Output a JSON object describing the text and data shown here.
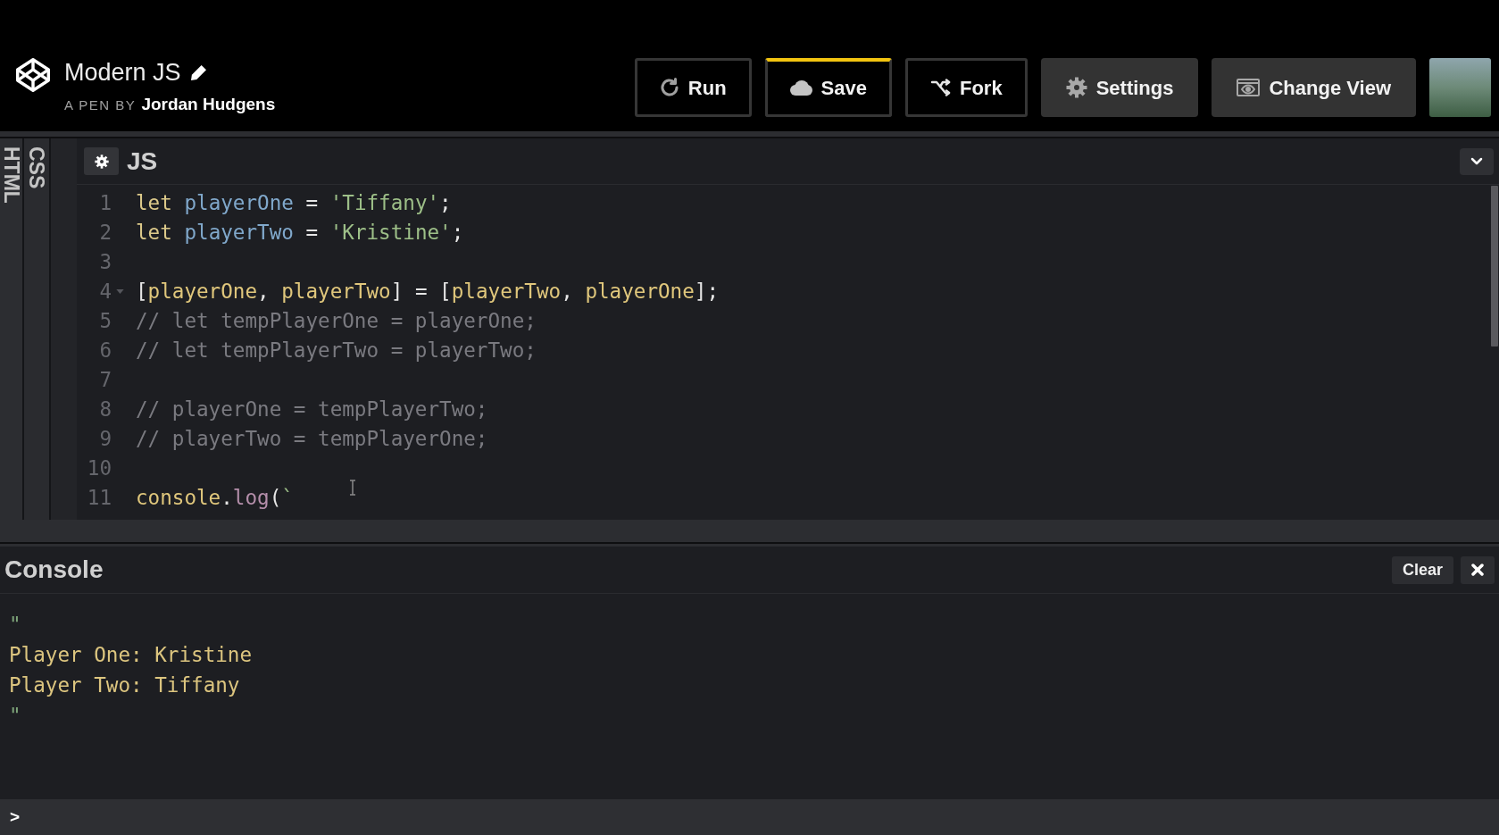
{
  "header": {
    "title": "Modern JS",
    "byline_label": "A PEN BY",
    "author": "Jordan Hudgens"
  },
  "toolbar": [
    {
      "label": "Run",
      "kind": "outline",
      "highlighted": false
    },
    {
      "label": "Save",
      "kind": "outline",
      "highlighted": true
    },
    {
      "label": "Fork",
      "kind": "outline",
      "highlighted": false
    },
    {
      "label": "Settings",
      "kind": "filled",
      "highlighted": false
    },
    {
      "label": "Change View",
      "kind": "filled",
      "highlighted": false
    }
  ],
  "side_tabs": [
    {
      "label": "HTML"
    },
    {
      "label": "CSS"
    }
  ],
  "editor": {
    "title": "JS",
    "lines": [
      {
        "number": "1",
        "foldable": false,
        "tokens": [
          {
            "text": "let ",
            "kind": "keyword"
          },
          {
            "text": "playerOne",
            "kind": "def"
          },
          {
            "text": " = ",
            "kind": "plain"
          },
          {
            "text": "'Tiffany'",
            "kind": "string"
          },
          {
            "text": ";",
            "kind": "plain"
          }
        ]
      },
      {
        "number": "2",
        "foldable": false,
        "tokens": [
          {
            "text": "let ",
            "kind": "keyword"
          },
          {
            "text": "playerTwo",
            "kind": "def"
          },
          {
            "text": " = ",
            "kind": "plain"
          },
          {
            "text": "'Kristine'",
            "kind": "string"
          },
          {
            "text": ";",
            "kind": "plain"
          }
        ]
      },
      {
        "number": "3",
        "foldable": false
      },
      {
        "number": "4",
        "foldable": true,
        "tokens": [
          {
            "text": "[",
            "kind": "plain"
          },
          {
            "text": "playerOne",
            "kind": "variable"
          },
          {
            "text": ", ",
            "kind": "plain"
          },
          {
            "text": "playerTwo",
            "kind": "variable"
          },
          {
            "text": "] = [",
            "kind": "plain"
          },
          {
            "text": "playerTwo",
            "kind": "variable"
          },
          {
            "text": ", ",
            "kind": "plain"
          },
          {
            "text": "playerOne",
            "kind": "variable"
          },
          {
            "text": "];",
            "kind": "plain"
          }
        ]
      },
      {
        "number": "5",
        "foldable": false,
        "tokens": [
          {
            "text": "// let tempPlayerOne = playerOne;",
            "kind": "comment"
          }
        ]
      },
      {
        "number": "6",
        "foldable": false,
        "tokens": [
          {
            "text": "// let tempPlayerTwo = playerTwo;",
            "kind": "comment"
          }
        ]
      },
      {
        "number": "7",
        "foldable": false
      },
      {
        "number": "8",
        "foldable": false,
        "tokens": [
          {
            "text": "// playerOne = tempPlayerTwo;",
            "kind": "comment"
          }
        ]
      },
      {
        "number": "9",
        "foldable": false,
        "tokens": [
          {
            "text": "// playerTwo = tempPlayerOne;",
            "kind": "comment"
          }
        ]
      },
      {
        "number": "10",
        "foldable": false
      },
      {
        "number": "11",
        "foldable": false,
        "tokens": [
          {
            "text": "console",
            "kind": "variable"
          },
          {
            "text": ".",
            "kind": "plain"
          },
          {
            "text": "log",
            "kind": "property"
          },
          {
            "text": "(",
            "kind": "plain"
          },
          {
            "text": "`",
            "kind": "string"
          }
        ]
      }
    ]
  },
  "console": {
    "title": "Console",
    "clear_label": "Clear",
    "output": [
      {
        "text": "\"",
        "kind": "quote"
      },
      {
        "text": "Player One: Kristine",
        "kind": "text"
      },
      {
        "text": "Player Two: Tiffany",
        "kind": "text"
      },
      {
        "text": "\"",
        "kind": "quote"
      }
    ],
    "prompt": ">"
  }
}
